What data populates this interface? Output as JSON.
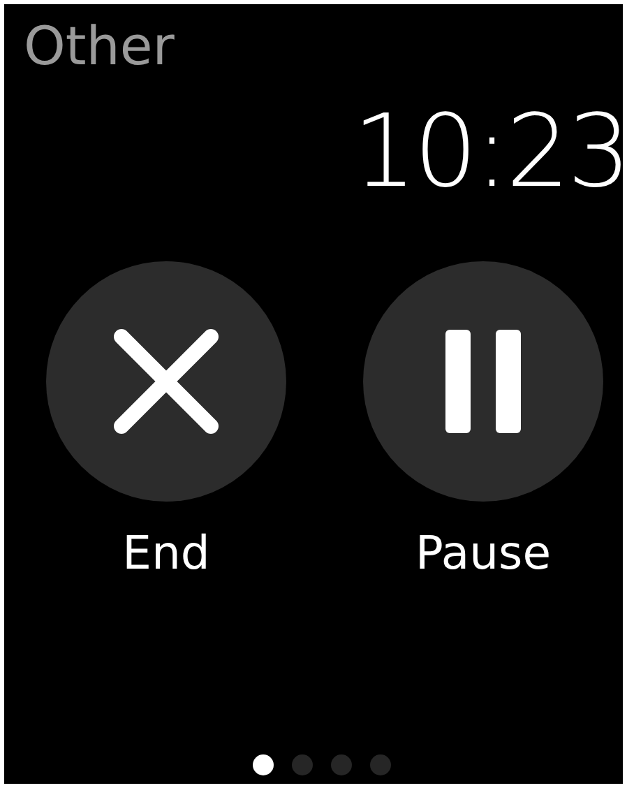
{
  "title": "Other",
  "time": "10:23",
  "buttons": [
    {
      "kind": "end",
      "label": "End"
    },
    {
      "kind": "pause",
      "label": "Pause"
    }
  ],
  "pages": [
    {
      "selected": true
    },
    {
      "selected": false
    },
    {
      "selected": false
    },
    {
      "selected": false
    }
  ]
}
